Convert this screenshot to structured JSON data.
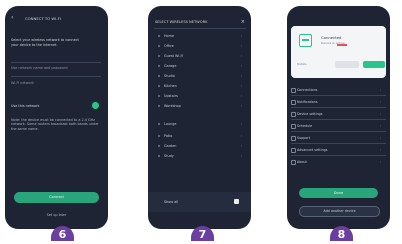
{
  "screens": [
    {
      "number": "6",
      "title": "CONNECT TO WI-FI",
      "back_label": "‹",
      "body_lines": [
        "Select your wireless network to connect",
        "your device to the internet.",
        "Use network name and password",
        "Wi-Fi network"
      ],
      "toggle_label": "Use this network",
      "info_text": "Note: the device must be connected to a 2.4 GHz network. Some routers broadcast both bands under the same name.",
      "primary_button": "Connect",
      "secondary_link": "Set up later"
    },
    {
      "number": "7",
      "title": "SELECT WIRELESS NETWORK",
      "close_label": "×",
      "networks": [
        "Home",
        "Office",
        "Guest Wi-Fi",
        "Garage",
        "Studio",
        "Kitchen",
        "Upstairs",
        "Workshop",
        "Lounge",
        "Patio",
        "Garden",
        "Study"
      ],
      "bottom_label": "Show all"
    },
    {
      "number": "8",
      "card": {
        "title": "Connected",
        "subtitle": "Device is online",
        "small_text": "Details"
      },
      "menu_items": [
        "Connections",
        "Notifications",
        "Device settings",
        "Schedule",
        "Support",
        "Advanced settings",
        "About"
      ],
      "primary_button": "Done",
      "outline_button": "Add another device"
    }
  ],
  "colors": {
    "phone_bg": "#1e2433",
    "accent_green": "#2bc48a",
    "badge_purple": "#6a3fa0"
  },
  "icons": [
    "back-arrow-icon",
    "close-icon",
    "chevron-right-icon",
    "wifi-logo-icon",
    "checkbox-icon"
  ]
}
